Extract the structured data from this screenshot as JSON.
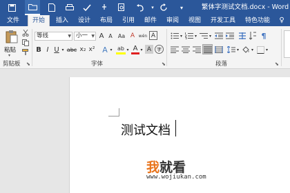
{
  "window": {
    "title": "繁体字测试文档.docx - Word",
    "accent": "#2b579a"
  },
  "quick_access": [
    {
      "name": "save-icon",
      "glyph": "💾"
    },
    {
      "name": "open-folder-icon",
      "glyph": "📂"
    },
    {
      "name": "new-document-icon",
      "glyph": "🗋"
    },
    {
      "name": "print-icon",
      "glyph": "⎙"
    },
    {
      "name": "spell-check-icon",
      "glyph": "✔"
    },
    {
      "name": "print-preview-icon",
      "glyph": "🔍"
    },
    {
      "name": "undo-icon",
      "glyph": "↶"
    },
    {
      "name": "redo-icon",
      "glyph": "↻"
    },
    {
      "name": "customize-icon",
      "glyph": "▾"
    }
  ],
  "tabs": [
    "文件",
    "开始",
    "插入",
    "设计",
    "布局",
    "引用",
    "邮件",
    "审阅",
    "视图",
    "开发工具",
    "特色功能"
  ],
  "selected_tab": "开始",
  "ribbon": {
    "clipboard": {
      "paste_label": "粘贴",
      "group_label": "剪贴板"
    },
    "font": {
      "font_name": "等线",
      "font_size": "小一",
      "group_label": "字体",
      "bold": "B",
      "italic": "I",
      "underline": "U",
      "strikethrough": "abc",
      "subscript": "x₂",
      "superscript": "x²",
      "text_effects": "A",
      "highlight": "ab",
      "font_color": "A",
      "char_shading": "A",
      "enclose": "字",
      "grow": "A",
      "shrink": "A",
      "change_case": "Aa",
      "clear_format": "A",
      "phonetic": "wén",
      "border": "A"
    },
    "paragraph": {
      "group_label": "段落"
    }
  },
  "document": {
    "text": "测试文档"
  },
  "watermark": {
    "part1": "我",
    "part2": "就看",
    "url": "www.wojiukan.com"
  }
}
